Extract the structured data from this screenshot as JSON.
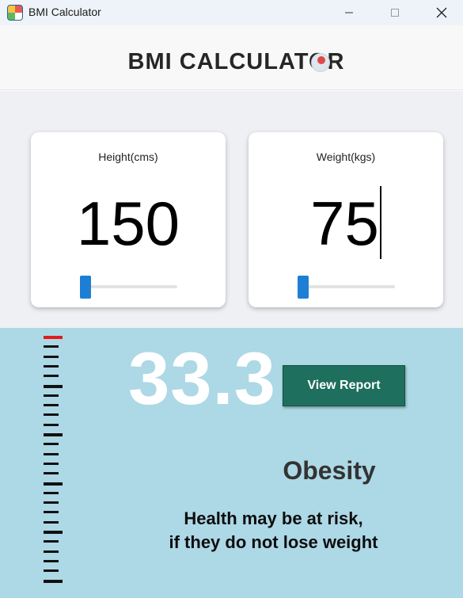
{
  "window": {
    "title": "BMI Calculator",
    "icon": "bmi-app-icon",
    "controls": [
      "minimize-icon",
      "maximize-icon",
      "close-icon"
    ]
  },
  "header": {
    "title": "BMI CALCULATOR"
  },
  "inputs": {
    "height": {
      "label": "Height(cms)",
      "value": "150",
      "slider_icon": "slider-thumb"
    },
    "weight": {
      "label": "Weight(kgs)",
      "value": "75",
      "slider_icon": "slider-thumb"
    }
  },
  "result": {
    "bmi": "33.3",
    "report_button_label": "View Report",
    "category": "Obesity",
    "message_line1": "Health may be at risk,",
    "message_line2": "if they do not lose weight",
    "indicator_icon": "bmi-scale-ruler"
  },
  "colors": {
    "result_background": "#add8e6",
    "button": "#1f6f5e",
    "slider_accent": "#1c7fd4",
    "scale_marker": "#e31b1b",
    "input_background": "#eef0f4"
  }
}
